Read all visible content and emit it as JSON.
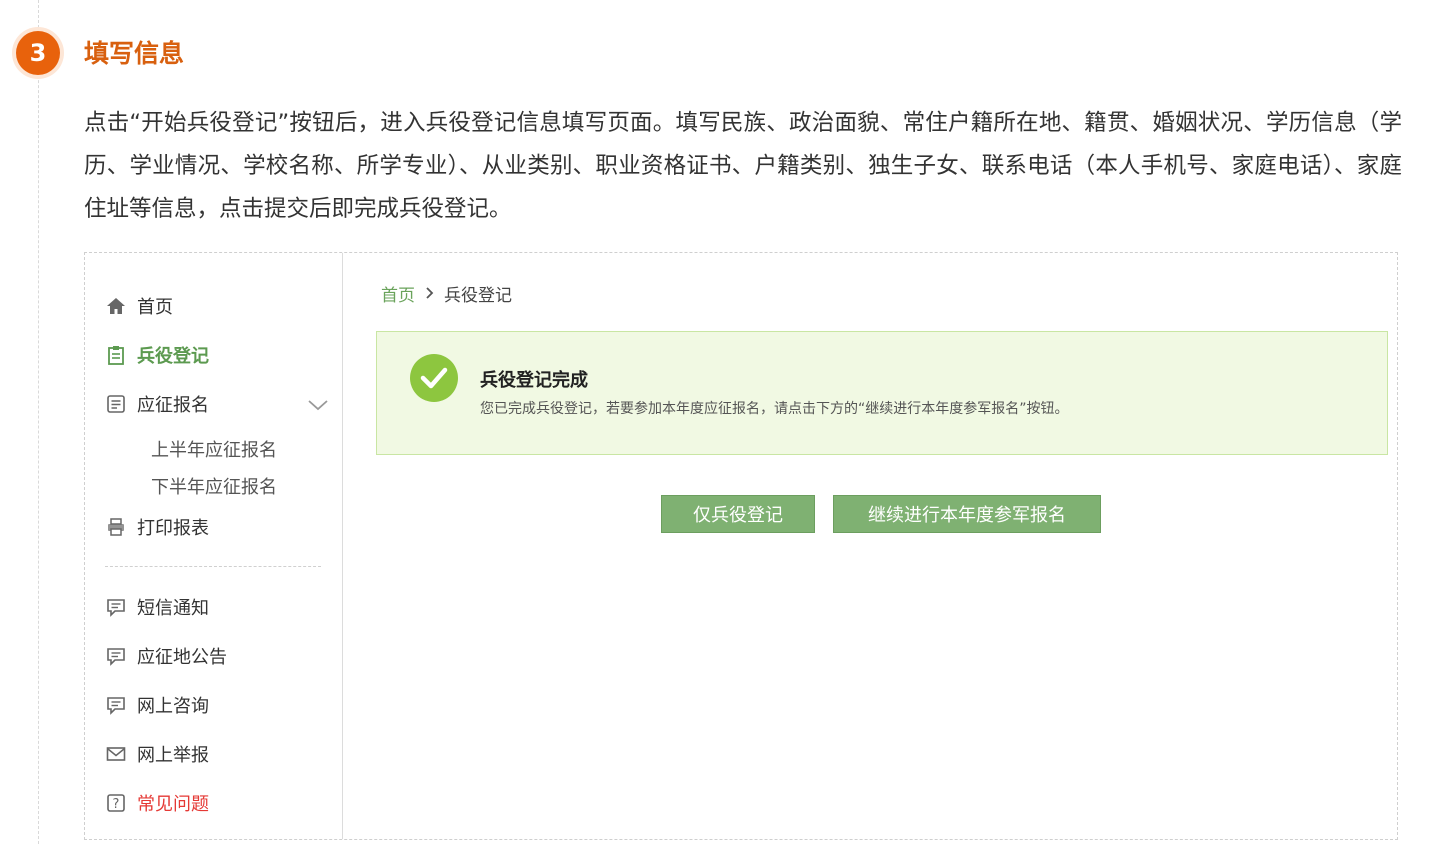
{
  "step": {
    "number": "3",
    "title": "填写信息"
  },
  "description": "点击“开始兵役登记”按钮后，进入兵役登记信息填写页面。填写民族、政治面貌、常住户籍所在地、籍贯、婚姻状况、学历信息（学历、学业情况、学校名称、所学专业）、从业类别、职业资格证书、户籍类别、独生子女、联系电话（本人手机号、家庭电话）、家庭住址等信息，点击提交后即完成兵役登记。",
  "sidebar": {
    "items": [
      {
        "label": "首页",
        "icon": "home-icon"
      },
      {
        "label": "兵役登记",
        "icon": "clipboard-icon",
        "active": true
      },
      {
        "label": "应征报名",
        "icon": "document-icon",
        "expanded": true
      },
      {
        "label": "打印报表",
        "icon": "printer-icon"
      },
      {
        "label": "短信通知",
        "icon": "message-icon"
      },
      {
        "label": "应征地公告",
        "icon": "message-icon"
      },
      {
        "label": "网上咨询",
        "icon": "message-icon"
      },
      {
        "label": "网上举报",
        "icon": "mail-icon"
      },
      {
        "label": "常见问题",
        "icon": "question-icon"
      }
    ],
    "subitems": [
      "上半年应征报名",
      "下半年应征报名"
    ]
  },
  "breadcrumb": {
    "home": "首页",
    "current": "兵役登记"
  },
  "notice": {
    "title": "兵役登记完成",
    "text": "您已完成兵役登记，若要参加本年度应征报名，请点击下方的“继续进行本年度参军报名”按钮。"
  },
  "buttons": {
    "only_register": "仅兵役登记",
    "continue_enlist": "继续进行本年度参军报名"
  },
  "colors": {
    "step_accent": "#d8600f",
    "active_green": "#5c9a50",
    "button_green": "#7fb172",
    "notice_bg": "#f1f9e3",
    "check_green": "#8dc63f",
    "faq_red": "#e53935"
  }
}
